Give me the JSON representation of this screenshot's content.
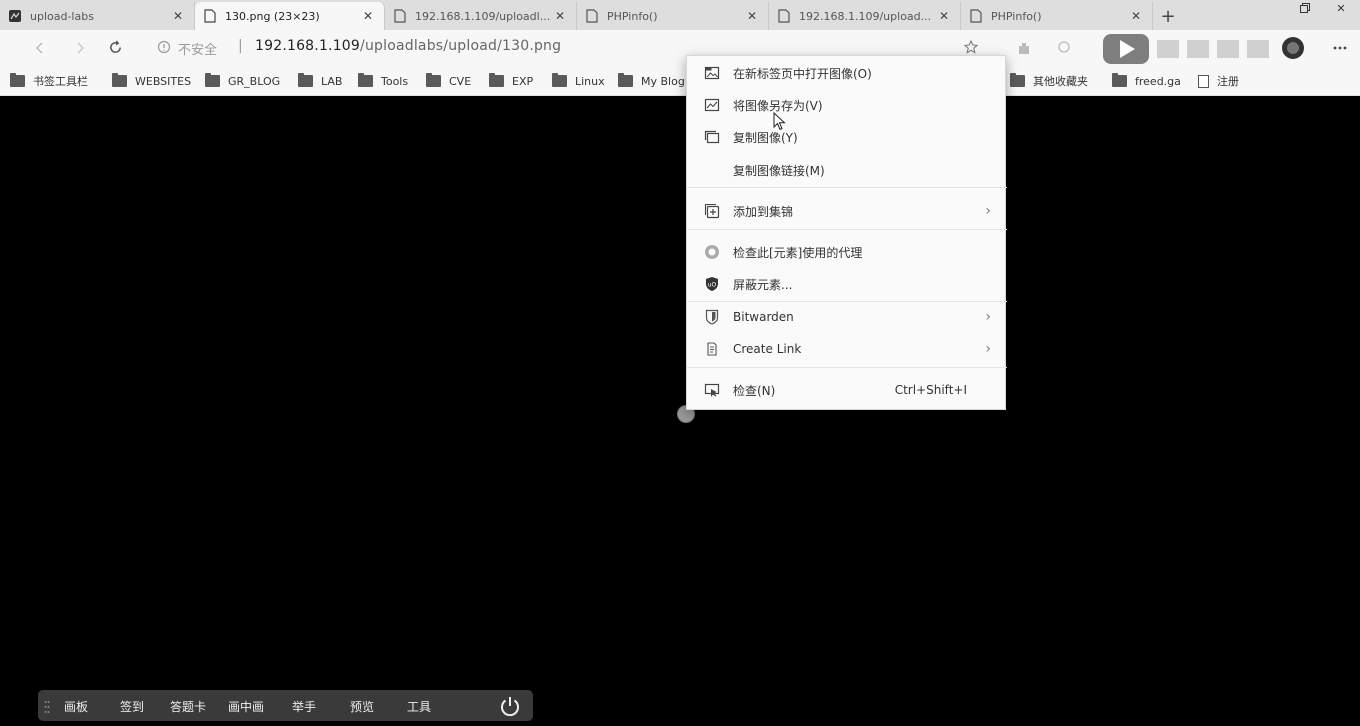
{
  "tabs": [
    {
      "title": "upload-labs",
      "favicon": "dark-app-icon",
      "active": false
    },
    {
      "title": "130.png (23×23)",
      "favicon": "page-icon",
      "active": true
    },
    {
      "title": "192.168.1.109/uploadl...",
      "favicon": "page-icon",
      "active": false
    },
    {
      "title": "PHPinfo()",
      "favicon": "page-icon",
      "active": false
    },
    {
      "title": "192.168.1.109/upload...",
      "favicon": "page-icon",
      "active": false
    },
    {
      "title": "PHPinfo()",
      "favicon": "page-icon",
      "active": false
    }
  ],
  "new_tab_label": "+",
  "address": {
    "status": "不安全",
    "separator": "|",
    "host": "192.168.1.109",
    "path": "/uploadlabs/upload/130.png"
  },
  "bookmarks": [
    {
      "label": "书签工具栏",
      "type": "folder"
    },
    {
      "label": "WEBSITES",
      "type": "folder"
    },
    {
      "label": "GR_BLOG",
      "type": "folder"
    },
    {
      "label": "LAB",
      "type": "folder"
    },
    {
      "label": "Tools",
      "type": "folder"
    },
    {
      "label": "CVE",
      "type": "folder"
    },
    {
      "label": "EXP",
      "type": "folder"
    },
    {
      "label": "Linux",
      "type": "folder"
    },
    {
      "label": "My Blog",
      "type": "folder"
    },
    {
      "label": "其他收藏夹",
      "type": "folder"
    },
    {
      "label": "freed.ga",
      "type": "folder"
    },
    {
      "label": "注册",
      "type": "page"
    }
  ],
  "context_menu": {
    "items": [
      {
        "label": "在新标签页中打开图像(O)",
        "icon": "open-image-new-tab-icon",
        "submenu": false,
        "shortcut": ""
      },
      {
        "label": "将图像另存为(V)",
        "icon": "save-image-icon",
        "submenu": false,
        "shortcut": ""
      },
      {
        "label": "复制图像(Y)",
        "icon": "copy-image-icon",
        "submenu": false,
        "shortcut": ""
      },
      {
        "label": "复制图像链接(M)",
        "icon": "",
        "submenu": false,
        "shortcut": ""
      },
      {
        "label": "添加到集锦",
        "icon": "collections-icon",
        "submenu": true,
        "shortcut": ""
      },
      {
        "label": "检查此[元素]使用的代理",
        "icon": "proxy-icon",
        "submenu": false,
        "shortcut": ""
      },
      {
        "label": "屏蔽元素...",
        "icon": "ublock-shield-icon",
        "submenu": false,
        "shortcut": ""
      },
      {
        "label": "Bitwarden",
        "icon": "bitwarden-icon",
        "submenu": true,
        "shortcut": ""
      },
      {
        "label": "Create Link",
        "icon": "create-link-icon",
        "submenu": true,
        "shortcut": ""
      },
      {
        "label": "检查(N)",
        "icon": "inspect-icon",
        "submenu": false,
        "shortcut": "Ctrl+Shift+I"
      }
    ],
    "submenu_glyph": "›"
  },
  "bottom_bar": {
    "items": [
      "画板",
      "签到",
      "答题卡",
      "画中画",
      "举手",
      "预览",
      "工具"
    ]
  },
  "colors": {
    "page_bg": "#000000",
    "chrome_bg": "#f7f7f7",
    "tabstrip_bg": "#dedede",
    "menu_bg": "#fafafa",
    "bottom_bar_bg": "#3a3a3a"
  }
}
